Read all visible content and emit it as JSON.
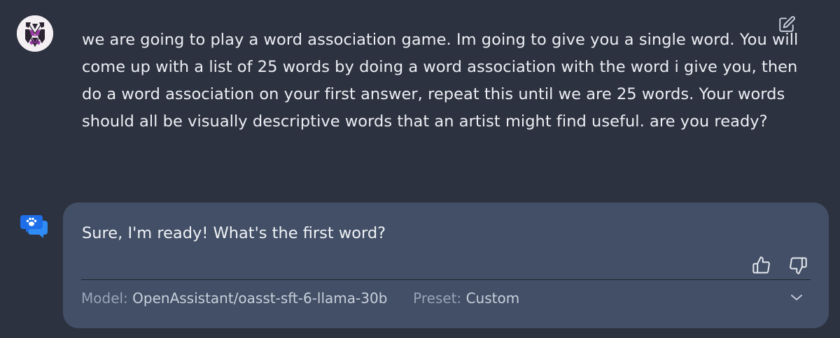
{
  "user_message": {
    "text": "we are going to play a word association game. Im going to give you a single word. You will come up with a list of 25 words by doing a word association with the word i give you, then do a word association on your first answer, repeat this until we are 25 words. Your words should all be visually descriptive words that an artist might find useful. are you ready?",
    "avatar_icon": "user-avatar-image",
    "edit_icon": "edit-icon"
  },
  "assistant_message": {
    "text": "Sure, I'm ready! What's the first word?",
    "avatar_icon": "chat-bubbles-paw-icon",
    "feedback": {
      "thumbs_up_icon": "thumbs-up-icon",
      "thumbs_down_icon": "thumbs-down-icon"
    },
    "meta": {
      "model_label": "Model:",
      "model_value": "OpenAssistant/oasst-sft-6-llama-30b",
      "preset_label": "Preset:",
      "preset_value": "Custom"
    },
    "expand_icon": "chevron-down-icon"
  },
  "colors": {
    "background": "#2d3240",
    "card": "#424f66",
    "text": "#eceef3",
    "meta_label": "#98a3b6",
    "meta_value": "#c9d0dc",
    "bot_icon": "#1d6ee8"
  }
}
